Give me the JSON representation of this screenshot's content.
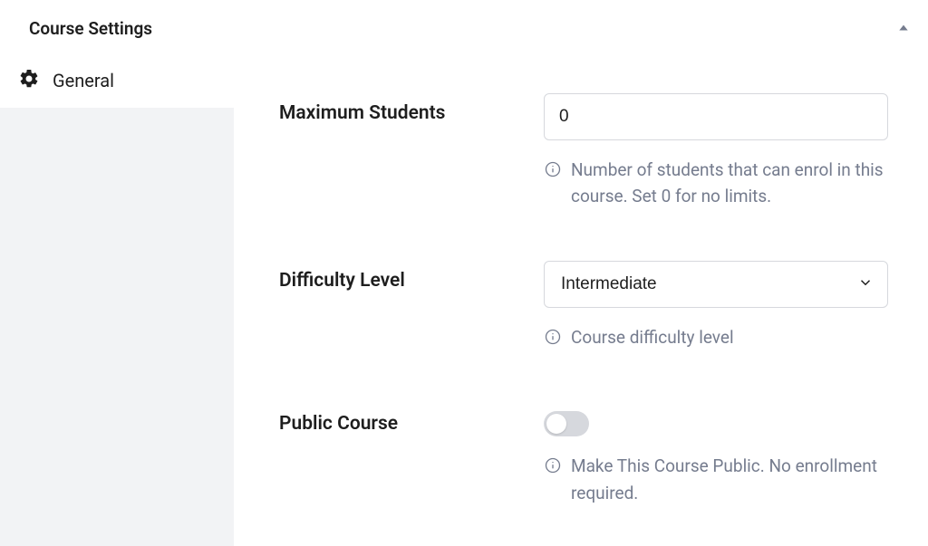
{
  "header": {
    "title": "Course Settings"
  },
  "sidebar": {
    "items": [
      {
        "label": "General"
      }
    ]
  },
  "fields": {
    "maxStudents": {
      "label": "Maximum Students",
      "value": "0",
      "helper": "Number of students that can enrol in this course. Set 0 for no limits."
    },
    "difficulty": {
      "label": "Difficulty Level",
      "selected": "Intermediate",
      "helper": "Course difficulty level"
    },
    "publicCourse": {
      "label": "Public Course",
      "enabled": false,
      "helper": "Make This Course Public. No enrollment required."
    }
  }
}
